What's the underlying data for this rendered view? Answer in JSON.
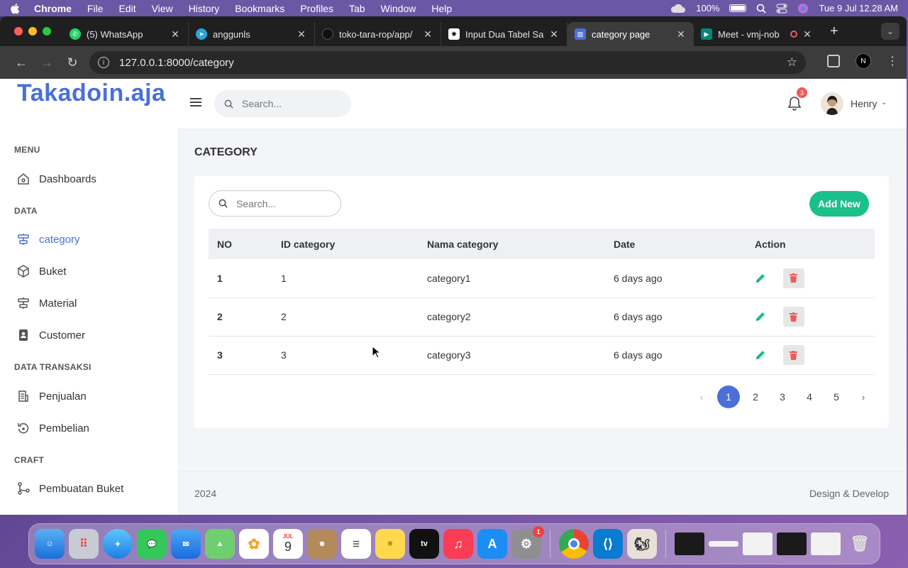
{
  "menubar": {
    "app_name": "Chrome",
    "items": [
      "File",
      "Edit",
      "View",
      "History",
      "Bookmarks",
      "Profiles",
      "Tab",
      "Window",
      "Help"
    ],
    "battery": "100%",
    "datetime": "Tue 9 Jul  12.28 AM"
  },
  "browser": {
    "tabs": [
      {
        "title": "(5) WhatsApp",
        "icon": "whatsapp-icon",
        "color": "#25d366"
      },
      {
        "title": "anggunls",
        "icon": "telegram-icon",
        "color": "#2aa3e0"
      },
      {
        "title": "toko-tara-rop/app/",
        "icon": "github-icon",
        "color": "#333333"
      },
      {
        "title": "Input Dua Tabel Sa",
        "icon": "chatgpt-icon",
        "color": "#ffffff"
      },
      {
        "title": "category page",
        "icon": "site-icon",
        "color": "#4a6fd8"
      },
      {
        "title": "Meet - vmj-nob",
        "icon": "meet-icon",
        "color": "#00897b"
      }
    ],
    "url": "127.0.0.1:8000/category"
  },
  "header": {
    "brand": "Takadoin.aja",
    "search_placeholder": "Search...",
    "notification_count": "3",
    "user_name": "Henry"
  },
  "sidebar": {
    "sections": {
      "menu": "MENU",
      "data": "DATA",
      "data_transaksi": "DATA TRANSAKSI",
      "craft": "CRAFT"
    },
    "items": {
      "dashboards": "Dashboards",
      "category": "category",
      "buket": "Buket",
      "material": "Material",
      "customer": "Customer",
      "penjualan": "Penjualan",
      "pembelian": "Pembelian",
      "pembuatan_buket": "Pembuatan Buket"
    }
  },
  "main": {
    "title": "CATEGORY",
    "search_placeholder": "Search...",
    "add_button": "Add New",
    "table": {
      "headers": [
        "NO",
        "ID category",
        "Nama category",
        "Date",
        "Action"
      ],
      "rows": [
        [
          "1",
          "1",
          "category1",
          "6 days ago"
        ],
        [
          "2",
          "2",
          "category2",
          "6 days ago"
        ],
        [
          "3",
          "3",
          "category3",
          "6 days ago"
        ]
      ]
    },
    "pagination": {
      "prev": "‹",
      "pages": [
        "1",
        "2",
        "3",
        "4",
        "5"
      ],
      "current": "1",
      "next": "›"
    }
  },
  "footer": {
    "year": "2024",
    "credit": "Design & Develop"
  },
  "dock": {
    "calendar_month": "JUL",
    "calendar_day": "9",
    "settings_badge": "1"
  },
  "colors": {
    "accent": "#4a6fd8",
    "success": "#1bbf8a",
    "danger": "#f05a5a"
  }
}
